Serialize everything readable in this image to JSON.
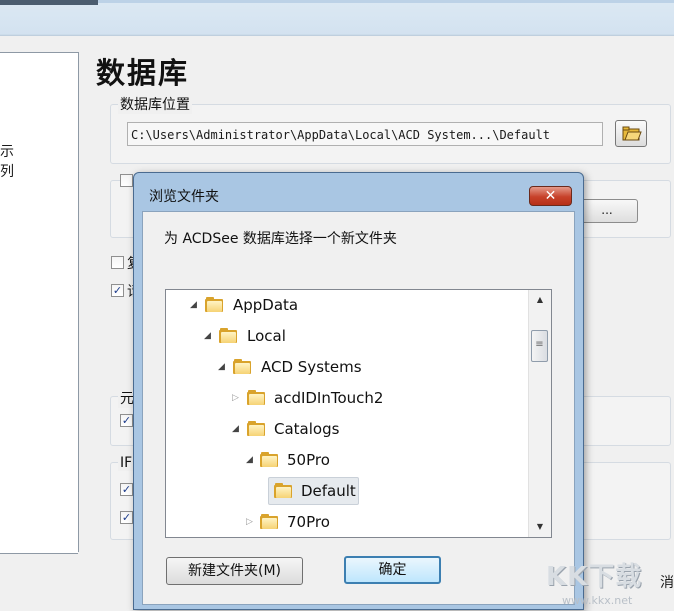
{
  "options_window": {
    "page_title": "数据库",
    "left_list_items": [
      "示",
      "列"
    ],
    "db_location_label": "数据库位置",
    "db_path": "C:\\Users\\Administrator\\AppData\\Local\\ACD System...\\Default",
    "partial_label_1": "元",
    "partial_label_2": "IF",
    "partial_check_1": "复",
    "partial_check_2": "请",
    "hidden_button_label": "...",
    "partial_bottom_label": "消"
  },
  "dialog": {
    "title": "浏览文件夹",
    "close_label": "✕",
    "instruction": "为 ACDSee 数据库选择一个新文件夹",
    "tree": [
      {
        "label": "AppData",
        "expanded": true
      },
      {
        "label": "Local",
        "expanded": true
      },
      {
        "label": "ACD Systems",
        "expanded": true
      },
      {
        "label": "acdIDInTouch2",
        "expanded": false
      },
      {
        "label": "Catalogs",
        "expanded": true
      },
      {
        "label": "50Pro",
        "expanded": true
      },
      {
        "label": "Default",
        "selected": true
      },
      {
        "label": "70Pro",
        "expanded": false
      }
    ],
    "new_folder_button": "新建文件夹(M)",
    "ok_button": "确定"
  },
  "watermark": {
    "text": "KK下载",
    "url": "www.kkx.net"
  },
  "colors": {
    "folder": "#d9a32c",
    "dialog_frame": "#a9c6e3",
    "close_button": "#c7412a",
    "default_button_border": "#3c7fb1"
  }
}
